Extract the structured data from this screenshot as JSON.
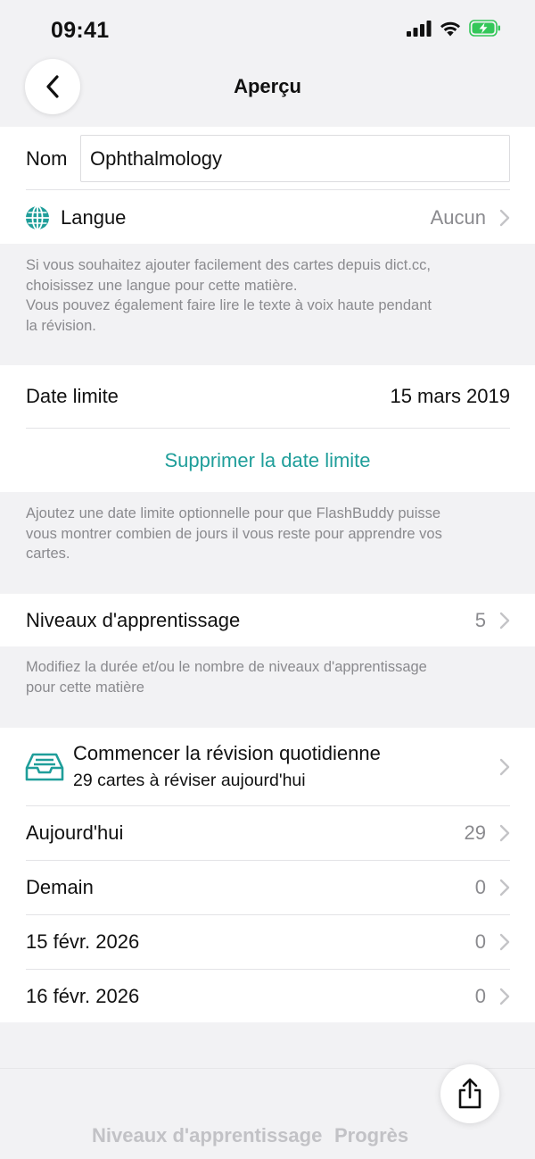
{
  "status_bar": {
    "time": "09:41"
  },
  "nav": {
    "title": "Aperçu"
  },
  "name_field": {
    "label": "Nom",
    "value": "Ophthalmology"
  },
  "language": {
    "label": "Langue",
    "value": "Aucun",
    "footer_line1": "Si vous souhaitez ajouter facilement des cartes depuis dict.cc,",
    "footer_line2": "choisissez une langue pour cette matière.",
    "footer_line3": "Vous pouvez également faire lire le texte à voix haute pendant",
    "footer_line4": "la révision."
  },
  "deadline": {
    "label": "Date limite",
    "value": "15 mars 2019",
    "remove_label": "Supprimer la date limite",
    "footer_line1": "Ajoutez une date limite optionnelle pour que FlashBuddy puisse",
    "footer_line2": "vous montrer combien de jours il vous reste pour apprendre vos",
    "footer_line3": "cartes."
  },
  "levels": {
    "label": "Niveaux d'apprentissage",
    "value": "5",
    "footer_line1": "Modifiez la durée et/ou le nombre de niveaux d'apprentissage",
    "footer_line2": "pour cette matière"
  },
  "review": {
    "title": "Commencer la révision quotidienne",
    "subtitle": "29 cartes à réviser aujourd'hui",
    "days": [
      {
        "label": "Aujourd'hui",
        "count": "29"
      },
      {
        "label": "Demain",
        "count": "0"
      },
      {
        "label": "15 févr. 2026",
        "count": "0"
      },
      {
        "label": "16 févr. 2026",
        "count": "0"
      }
    ]
  },
  "tabs": {
    "levels": "Niveaux d'apprentissage",
    "progress": "Progrès"
  },
  "colors": {
    "accent": "#1f9e9a",
    "background": "#f2f2f4",
    "secondary_text": "#8a8a8e",
    "battery": "#34c759"
  },
  "icons": [
    "back-chevron-icon",
    "globe-icon",
    "chevron-right-icon",
    "inbox-tray-icon",
    "share-icon",
    "cellular-signal-icon",
    "wifi-icon",
    "battery-charging-icon"
  ]
}
